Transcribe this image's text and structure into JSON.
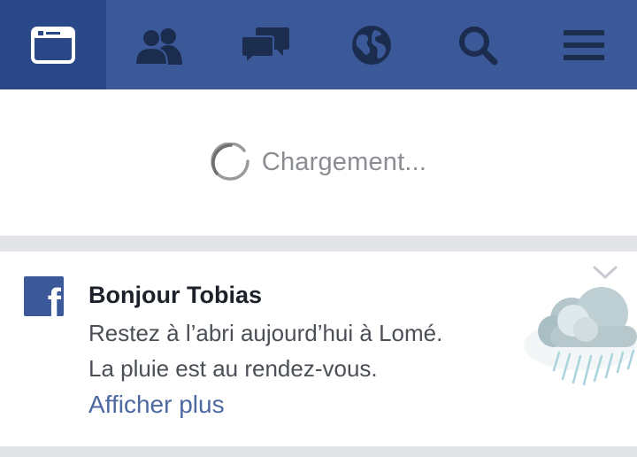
{
  "nav": {
    "tabs": [
      {
        "icon": "news-feed-icon",
        "active": true
      },
      {
        "icon": "friends-icon",
        "active": false
      },
      {
        "icon": "messages-icon",
        "active": false
      },
      {
        "icon": "notifications-globe-icon",
        "active": false
      },
      {
        "icon": "search-icon",
        "active": false
      },
      {
        "icon": "menu-icon",
        "active": false
      }
    ]
  },
  "loading": {
    "text": "Chargement..."
  },
  "card": {
    "logo_letter": "f",
    "title": "Bonjour Tobias",
    "line1": "Restez à l’abri aujourd’hui à Lomé.",
    "line2": "La pluie est au rendez-vous.",
    "link": "Afficher plus",
    "weather_icon": "rain-cloud-icon",
    "dismiss_icon": "chevron-down-icon"
  },
  "colors": {
    "brand": "#3b5998",
    "active_tab": "#2a4887",
    "link": "#4e69a2",
    "divider": "#e3e4e8"
  }
}
